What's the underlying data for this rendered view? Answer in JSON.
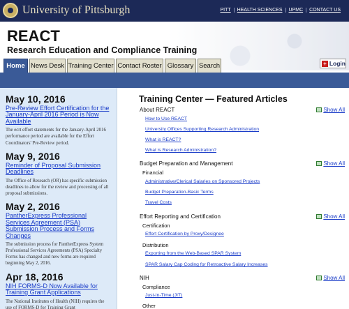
{
  "topbar": {
    "university": "University of Pittsburgh",
    "links": [
      "PITT",
      "HEALTH SCIENCES",
      "UPMC",
      "CONTACT US"
    ]
  },
  "header": {
    "title": "REACT",
    "subtitle": "Research Education and Compliance Training"
  },
  "tabs": [
    "Home",
    "News Desk",
    "Training Center",
    "Contact Roster",
    "Glossary",
    "Search"
  ],
  "login_label": "Login",
  "news": [
    {
      "date": "May 10, 2016",
      "title": "Pre-Review Effort Certification for the January-April 2016 Period is Now Available",
      "body": "The ecrt effort statements for the January-April 2016 performance period are available for the Effort Coordinators' Pre-Review period."
    },
    {
      "date": "May 9, 2016",
      "title": "Reminder of Proposal Submission Deadlines",
      "body": "The Office of Research (OR) has specific submission deadlines to allow for the review and processing of all proposal submissions."
    },
    {
      "date": "May 2, 2016",
      "title": "PantherExpress Professional Services Agreement (PSA) Submission Process and Forms Changes",
      "body": "The submission process for PantherExpress System Professional Services Agreements (PSA) Specialty Forms has changed and new forms are required beginning May 2, 2016."
    },
    {
      "date": "Apr 18, 2016",
      "title": "NIH FORMS-D Now Available for Training Grant Applications",
      "body": "The National Institutes of Health (NIH) requires the use of FORMS-D for Training Grant"
    }
  ],
  "training": {
    "title": "Training Center — Featured Articles",
    "show_all": "Show All",
    "about": {
      "label": "About REACT",
      "links": [
        "How to Use REACT",
        "University Offices Supporting Research Administration",
        "What is REACT?",
        "What is Research Administration?"
      ]
    },
    "budget": {
      "label": "Budget Preparation and Management",
      "sub": "Financial",
      "links": [
        "Administrative/Clerical Salaries on Sponsored Projects",
        "Budget Preparation-Basic Terms",
        "Travel Costs"
      ]
    },
    "effort": {
      "label": "Effort Reporting and Certification",
      "sub1": "Certification",
      "link1": "Effort Certification by Proxy/Designee",
      "sub2": "Distribution",
      "links2": [
        "Exporting from the Web-Based SPAR System",
        "SPAR Salary Cap Coding for Retroactive Salary Increases"
      ]
    },
    "nih": {
      "label": "NIH",
      "sub": "Compliance",
      "link": "Just-In-Time (JIT)",
      "sub2": "Other"
    }
  }
}
